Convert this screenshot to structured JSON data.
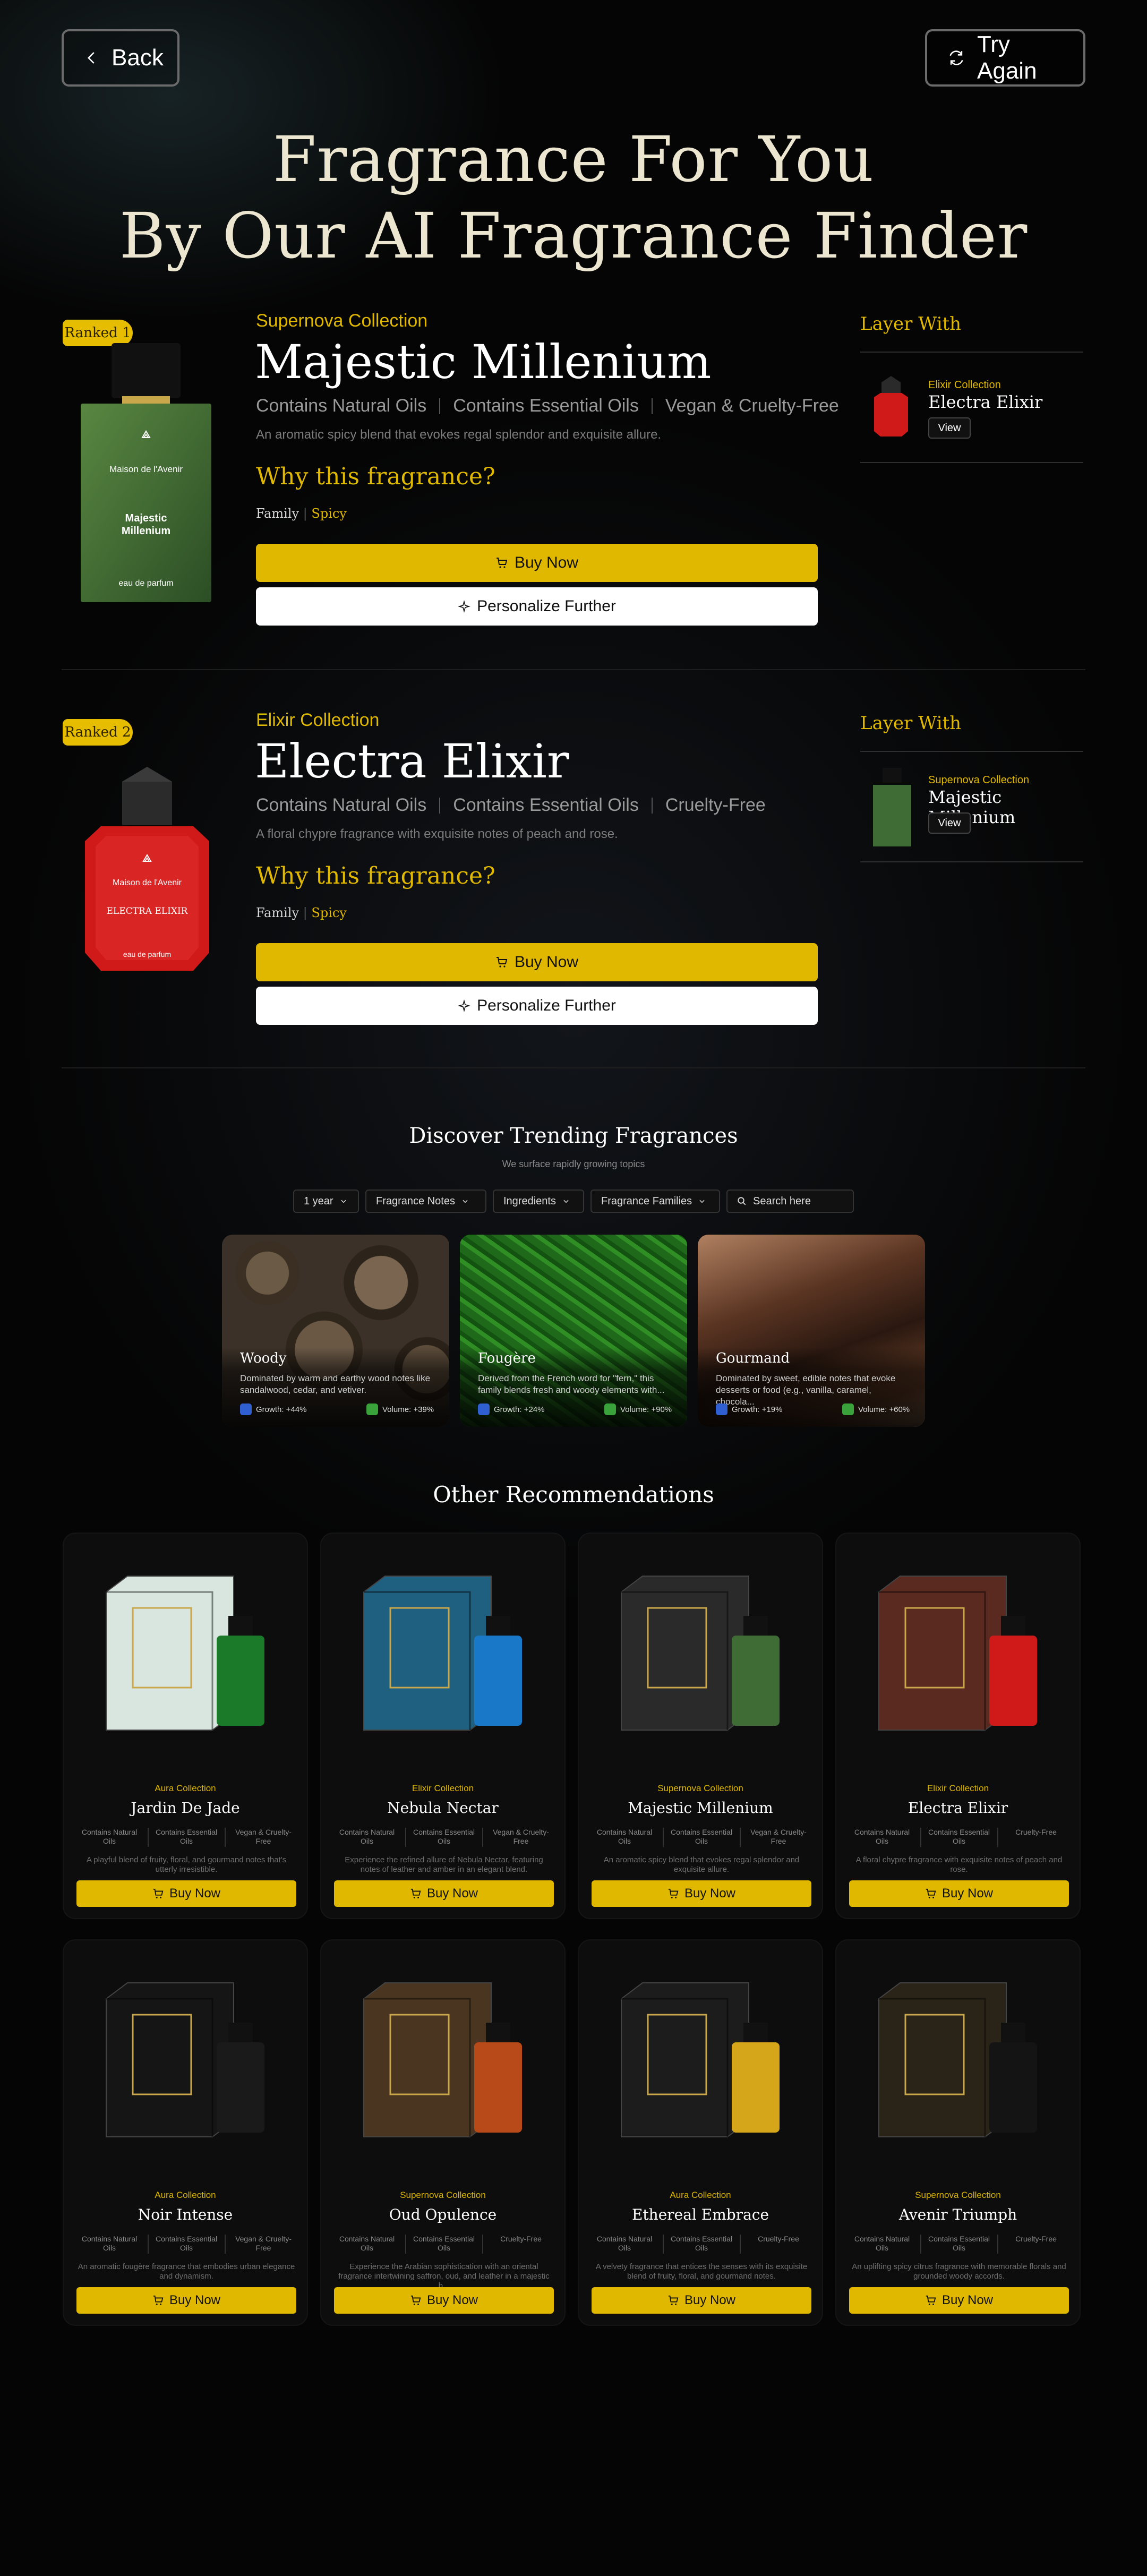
{
  "header": {
    "back_label": "Back",
    "try_again_label": "Try Again"
  },
  "hero": {
    "line1": "Fragrance For You",
    "line2": "By Our AI Fragrance Finder"
  },
  "ranked": [
    {
      "badge": "Ranked 1",
      "collection": "Supernova Collection",
      "name": "Majestic Millenium",
      "features": [
        "Contains Natural Oils",
        "Contains Essential Oils",
        "Vegan & Cruelty-Free"
      ],
      "description": "An aromatic spicy blend that evokes regal splendor and exquisite allure.",
      "why": "Why this fragrance?",
      "family_label": "Family",
      "family_value": "Spicy",
      "buy_label": "Buy Now",
      "personalize_label": "Personalize Further",
      "bottle": {
        "brand": "Maison de l'Avenir",
        "label": "Majestic Millenium",
        "footer": "eau de parfum",
        "color": "#3f6b35"
      },
      "layer": {
        "title": "Layer With",
        "collection": "Elixir Collection",
        "name": "Electra Elixir",
        "view_label": "View"
      }
    },
    {
      "badge": "Ranked 2",
      "collection": "Elixir Collection",
      "name": "Electra Elixir",
      "features": [
        "Contains Natural Oils",
        "Contains Essential Oils",
        "Cruelty-Free"
      ],
      "description": "A floral chypre fragrance with exquisite notes of peach and rose.",
      "why": "Why this fragrance?",
      "family_label": "Family",
      "family_value": "Spicy",
      "buy_label": "Buy Now",
      "personalize_label": "Personalize Further",
      "bottle": {
        "brand": "Maison de l'Avenir",
        "label": "ELECTRA ELIXIR",
        "footer": "eau de parfum",
        "color": "#d01a1a"
      },
      "layer": {
        "title": "Layer With",
        "collection": "Supernova Collection",
        "name": "Majestic Millenium",
        "view_label": "View"
      }
    }
  ],
  "trending": {
    "title": "Discover Trending Fragrances",
    "subtitle": "We surface rapidly growing topics",
    "filters": [
      "1 year",
      "Fragrance Notes",
      "Ingredients",
      "Fragrance Families"
    ],
    "search_placeholder": "Search here",
    "cards": [
      {
        "name": "Woody",
        "desc": "Dominated by warm and earthy wood notes like sandalwood, cedar, and vetiver.",
        "growth": "Growth: +44%",
        "volume": "Volume: +39%"
      },
      {
        "name": "Fougère",
        "desc": "Derived from the French word for \"fern,\" this family blends fresh and woody elements with...",
        "growth": "Growth: +24%",
        "volume": "Volume: +90%"
      },
      {
        "name": "Gourmand",
        "desc": "Dominated by sweet, edible notes that evoke desserts or food (e.g., vanilla, caramel, chocola...",
        "growth": "Growth: +19%",
        "volume": "Volume: +60%"
      }
    ]
  },
  "other": {
    "title": "Other Recommendations",
    "buy_label": "Buy Now",
    "items": [
      {
        "collection": "Aura Collection",
        "name": "Jardin De Jade",
        "features": [
          "Contains Natural Oils",
          "Contains Essential Oils",
          "Vegan & Cruelty-Free"
        ],
        "desc": "A playful blend of fruity, floral, and gourmand notes that's utterly irresistible.",
        "box": "#d8e6df",
        "bottle": "#1a7a2a"
      },
      {
        "collection": "Elixir Collection",
        "name": "Nebula Nectar",
        "features": [
          "Contains Natural Oils",
          "Contains Essential Oils",
          "Vegan & Cruelty-Free"
        ],
        "desc": "Experience the refined allure of Nebula Nectar, featuring notes of leather and amber in an elegant blend.",
        "box": "#1f5f7f",
        "bottle": "#1a78c8"
      },
      {
        "collection": "Supernova Collection",
        "name": "Majestic Millenium",
        "features": [
          "Contains Natural Oils",
          "Contains Essential Oils",
          "Vegan & Cruelty-Free"
        ],
        "desc": "An aromatic spicy blend that evokes regal splendor and exquisite allure.",
        "box": "#2a2a2a",
        "bottle": "#3f6b35"
      },
      {
        "collection": "Elixir Collection",
        "name": "Electra Elixir",
        "features": [
          "Contains Natural Oils",
          "Contains Essential Oils",
          "Cruelty-Free"
        ],
        "desc": "A floral chypre fragrance with exquisite notes of peach and rose.",
        "box": "#5a2a20",
        "bottle": "#d01a1a"
      },
      {
        "collection": "Aura Collection",
        "name": "Noir Intense",
        "features": [
          "Contains Natural Oils",
          "Contains Essential Oils",
          "Vegan & Cruelty-Free"
        ],
        "desc": "An aromatic fougère fragrance that embodies urban elegance and dynamism.",
        "box": "#151515",
        "bottle": "#1a1a1a"
      },
      {
        "collection": "Supernova Collection",
        "name": "Oud Opulence",
        "features": [
          "Contains Natural Oils",
          "Contains Essential Oils",
          "Cruelty-Free"
        ],
        "desc": "Experience the Arabian sophistication with an oriental fragrance intertwining saffron, oud, and leather in a majestic b...",
        "box": "#4a3520",
        "bottle": "#b84a1a"
      },
      {
        "collection": "Aura Collection",
        "name": "Ethereal Embrace",
        "features": [
          "Contains Natural Oils",
          "Contains Essential Oils",
          "Cruelty-Free"
        ],
        "desc": "A velvety fragrance that entices the senses with its exquisite blend of fruity, floral, and gourmand notes.",
        "box": "#1c1c1c",
        "bottle": "#d6a61a"
      },
      {
        "collection": "Supernova Collection",
        "name": "Avenir Triumph",
        "features": [
          "Contains Natural Oils",
          "Contains Essential Oils",
          "Cruelty-Free"
        ],
        "desc": "An uplifting spicy citrus fragrance with memorable florals and grounded woody accords.",
        "box": "#2a2418",
        "bottle": "#141414"
      }
    ]
  },
  "colors": {
    "accent": "#e0b800",
    "background": "#050505",
    "card": "#0d0d0d"
  }
}
